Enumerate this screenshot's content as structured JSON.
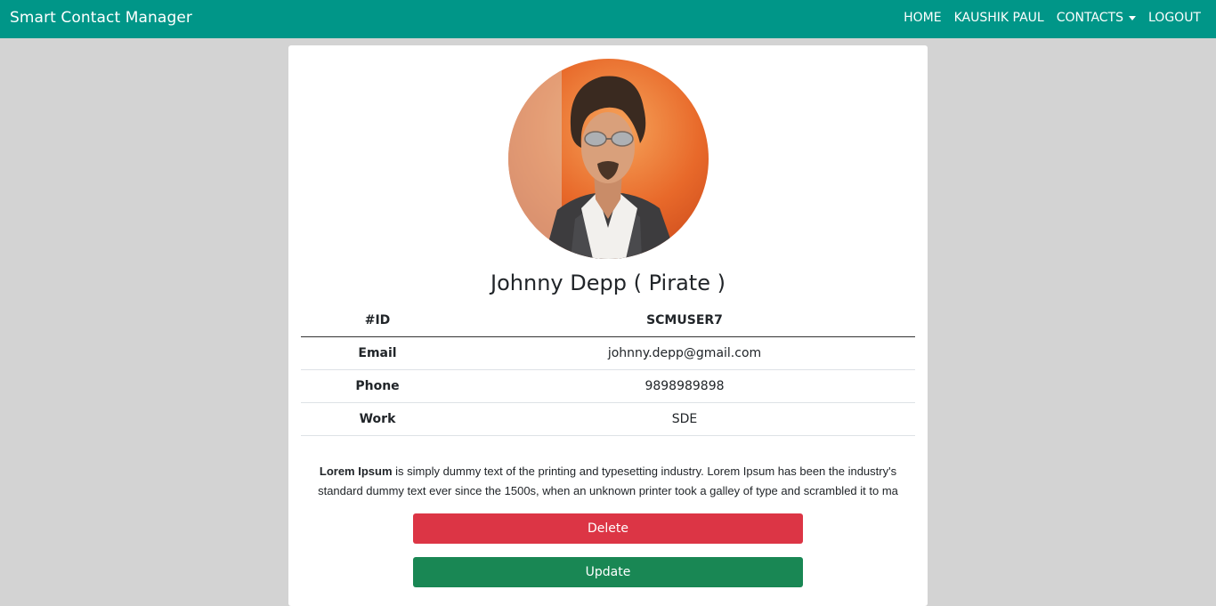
{
  "navbar": {
    "brand": "Smart Contact Manager",
    "links": [
      "HOME",
      "KAUSHIK PAUL",
      "CONTACTS",
      "LOGOUT"
    ],
    "color": "#009688"
  },
  "contact": {
    "name": "Johnny Depp ( Pirate )",
    "table": {
      "header": {
        "label": "#ID",
        "value": "SCMUSER7"
      },
      "rows": [
        {
          "label": "Email",
          "value": "johnny.depp@gmail.com"
        },
        {
          "label": "Phone",
          "value": "9898989898"
        },
        {
          "label": "Work",
          "value": "SDE"
        }
      ]
    },
    "description": {
      "bold": "Lorem Ipsum",
      "text": " is simply dummy text of the printing and typesetting industry. Lorem Ipsum has been the industry's standard dummy text ever since the 1500s, when an unknown printer took a galley of type and scrambled it to ma"
    }
  },
  "actions": {
    "delete_label": "Delete",
    "update_label": "Update",
    "delete_color": "#dc3545",
    "update_color": "#198754"
  }
}
